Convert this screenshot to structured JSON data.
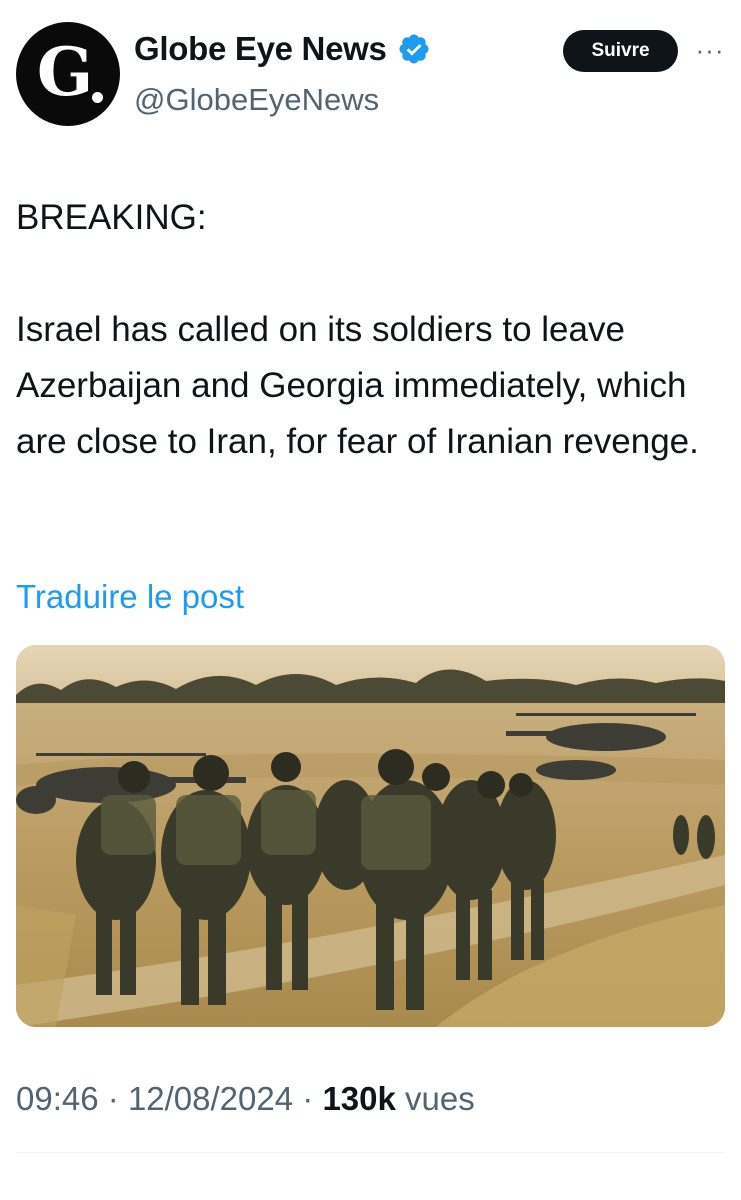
{
  "author": {
    "display_name": "Globe Eye News",
    "handle": "@GlobeEyeNews",
    "avatar_letter": "G",
    "verified": true
  },
  "actions": {
    "follow_label": "Suivre",
    "more_label": "···"
  },
  "tweet": {
    "headline": "BREAKING:",
    "body": "Israel has called on its soldiers to leave Azerbaijan and Georgia immediately, which are close to Iran, for fear of Iranian revenge.",
    "translate_label": "Traduire le post"
  },
  "media": {
    "description_icon": "photo-soldiers-helicopters"
  },
  "meta": {
    "time": "09:46",
    "separator": "·",
    "date": "12/08/2024",
    "views_count": "130k",
    "views_label": "vues"
  },
  "colors": {
    "link": "#1d9bf0",
    "verified": "#1d9bf0",
    "secondary_text": "#536471",
    "primary_text": "#0f1419"
  }
}
